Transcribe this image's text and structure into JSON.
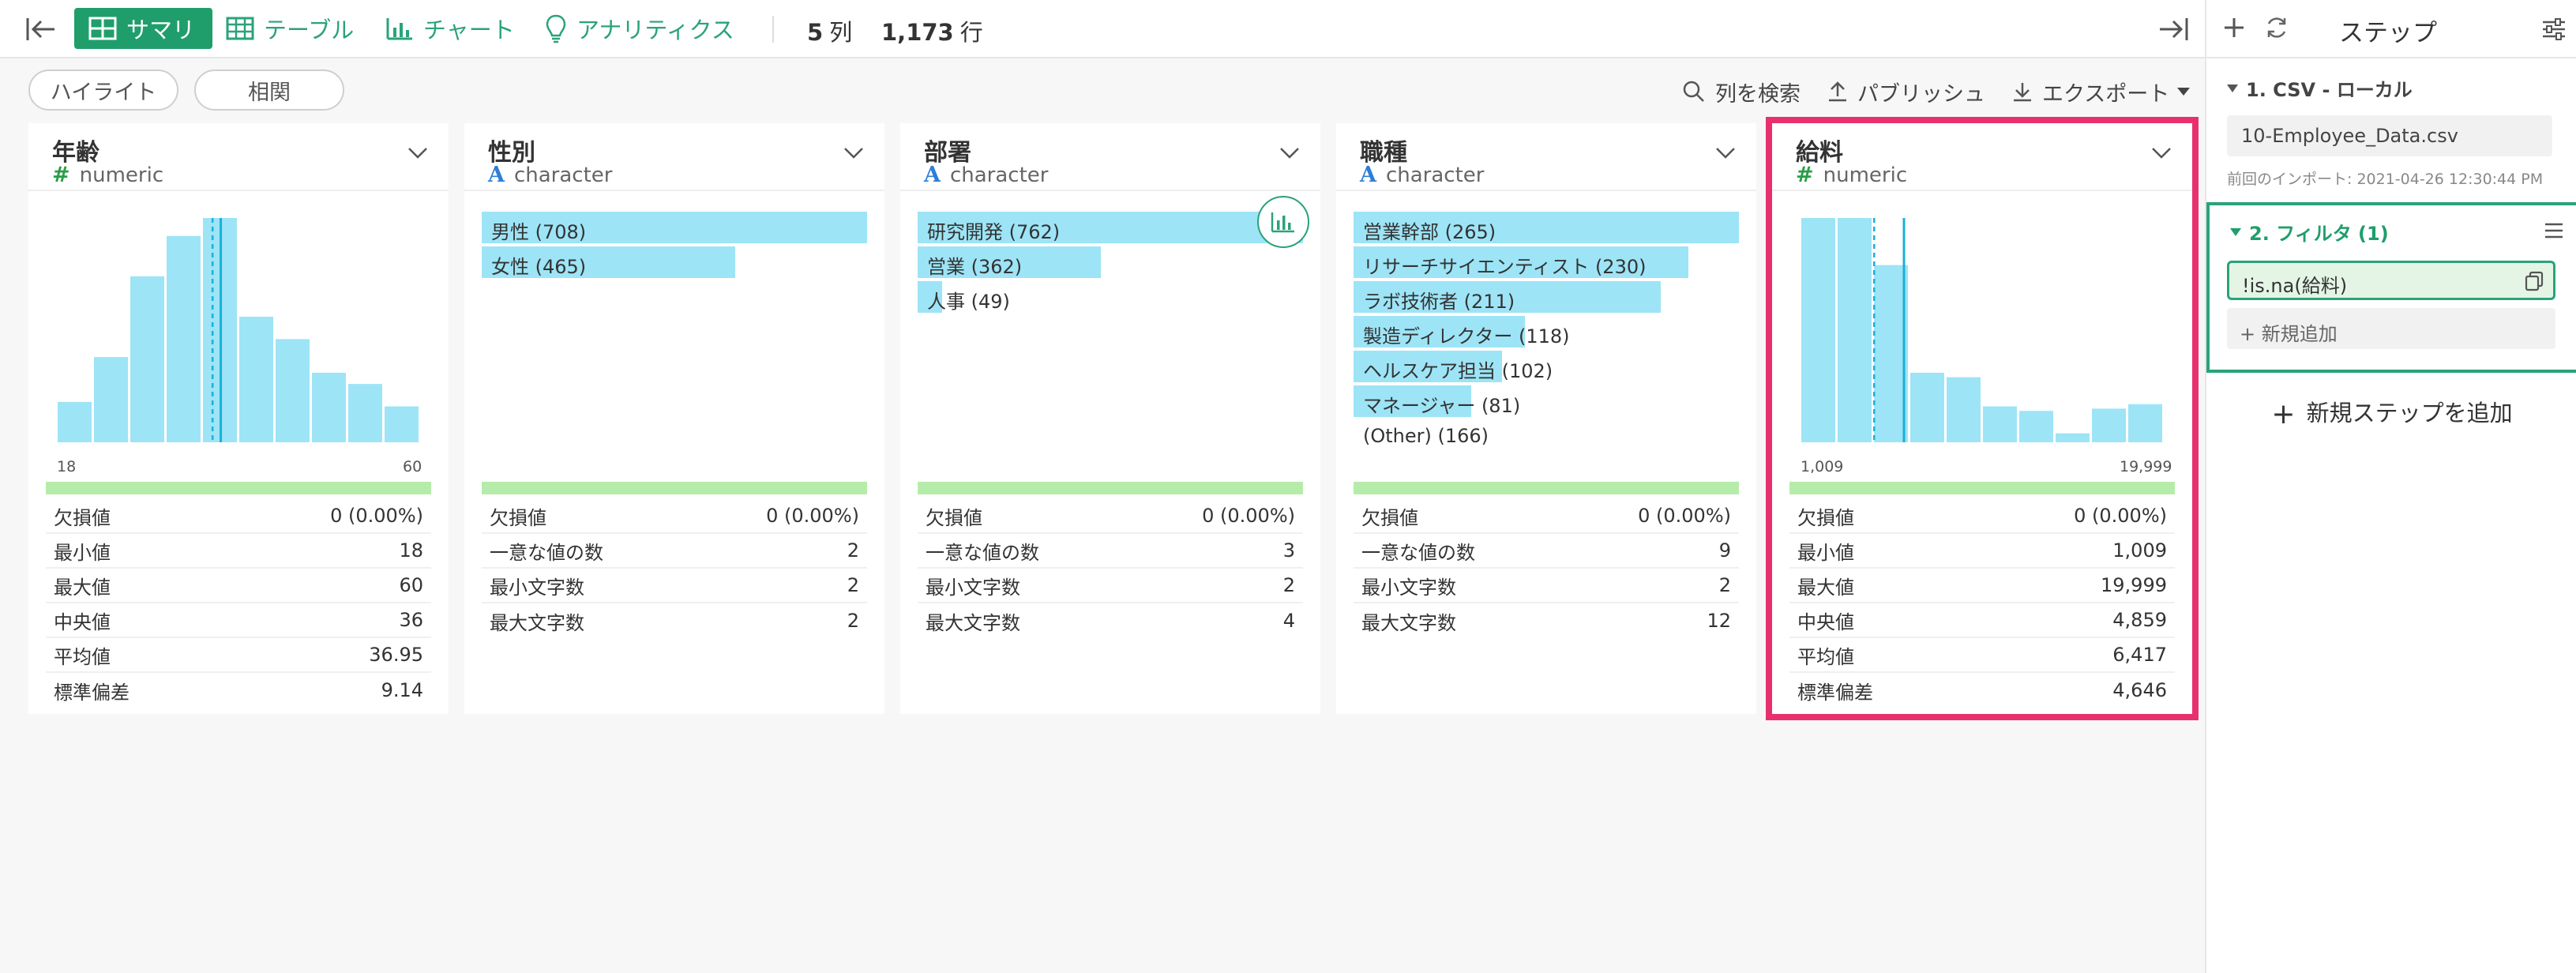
{
  "toolbar": {
    "tabs": [
      {
        "label": "サマリ",
        "icon": "summary-grid-icon",
        "active": true
      },
      {
        "label": "テーブル",
        "icon": "table-icon",
        "active": false
      },
      {
        "label": "チャート",
        "icon": "bar-chart-icon",
        "active": false
      },
      {
        "label": "アナリティクス",
        "icon": "lightbulb-icon",
        "active": false
      }
    ],
    "columns_count": "5",
    "columns_unit": "列",
    "rows_count": "1,173",
    "rows_unit": "行"
  },
  "subbar": {
    "highlight_label": "ハイライト",
    "correlation_label": "相関",
    "search_label": "列を検索",
    "publish_label": "パブリッシュ",
    "export_label": "エクスポート"
  },
  "colors": {
    "accent": "#1f9e6c",
    "bar": "#9de4f6",
    "bar_edge": "#3fc4e8",
    "quality": "#b6ecaa",
    "highlight": "#e8306f"
  },
  "columns": [
    {
      "name": "年齢",
      "type": "numeric",
      "range_min": "18",
      "range_max": "60",
      "stats": [
        {
          "label": "欠損値",
          "value": "0 (0.00%)"
        },
        {
          "label": "最小値",
          "value": "18"
        },
        {
          "label": "最大値",
          "value": "60"
        },
        {
          "label": "中央値",
          "value": "36"
        },
        {
          "label": "平均値",
          "value": "36.95"
        },
        {
          "label": "標準偏差",
          "value": "9.14"
        }
      ]
    },
    {
      "name": "性別",
      "type": "character",
      "categories": [
        {
          "label": "男性 (708)",
          "count": 708
        },
        {
          "label": "女性 (465)",
          "count": 465
        }
      ],
      "stats": [
        {
          "label": "欠損値",
          "value": "0 (0.00%)"
        },
        {
          "label": "一意な値の数",
          "value": "2"
        },
        {
          "label": "最小文字数",
          "value": "2"
        },
        {
          "label": "最大文字数",
          "value": "2"
        }
      ]
    },
    {
      "name": "部署",
      "type": "character",
      "categories": [
        {
          "label": "研究開発 (762)",
          "count": 762
        },
        {
          "label": "営業 (362)",
          "count": 362
        },
        {
          "label": "人事 (49)",
          "count": 49
        }
      ],
      "stats": [
        {
          "label": "欠損値",
          "value": "0 (0.00%)"
        },
        {
          "label": "一意な値の数",
          "value": "3"
        },
        {
          "label": "最小文字数",
          "value": "2"
        },
        {
          "label": "最大文字数",
          "value": "4"
        }
      ]
    },
    {
      "name": "職種",
      "type": "character",
      "categories": [
        {
          "label": "営業幹部 (265)",
          "count": 265
        },
        {
          "label": "リサーチサイエンティスト (230)",
          "count": 230
        },
        {
          "label": "ラボ技術者 (211)",
          "count": 211
        },
        {
          "label": "製造ディレクター (118)",
          "count": 118
        },
        {
          "label": "ヘルスケア担当 (102)",
          "count": 102
        },
        {
          "label": "マネージャー (81)",
          "count": 81
        },
        {
          "label": "(Other) (166)",
          "count": 0
        }
      ],
      "stats": [
        {
          "label": "欠損値",
          "value": "0 (0.00%)"
        },
        {
          "label": "一意な値の数",
          "value": "9"
        },
        {
          "label": "最小文字数",
          "value": "2"
        },
        {
          "label": "最大文字数",
          "value": "12"
        }
      ]
    },
    {
      "name": "給料",
      "type": "numeric",
      "range_min": "1,009",
      "range_max": "19,999",
      "stats": [
        {
          "label": "欠損値",
          "value": "0 (0.00%)"
        },
        {
          "label": "最小値",
          "value": "1,009"
        },
        {
          "label": "最大値",
          "value": "19,999"
        },
        {
          "label": "中央値",
          "value": "4,859"
        },
        {
          "label": "平均値",
          "value": "6,417"
        },
        {
          "label": "標準偏差",
          "value": "4,646"
        }
      ]
    }
  ],
  "chart_data": [
    {
      "type": "bar",
      "categories": [
        "1",
        "2",
        "3",
        "4",
        "5",
        "6",
        "7",
        "8",
        "9",
        "10"
      ],
      "values": [
        18,
        38,
        74,
        92,
        100,
        56,
        46,
        31,
        26,
        16
      ],
      "ylim": [
        0,
        100
      ],
      "xlim": [
        18,
        60
      ],
      "median": 36,
      "mean": 36.95
    },
    {
      "type": "bar",
      "categories": [
        "1",
        "2",
        "3",
        "4",
        "5",
        "6",
        "7",
        "8",
        "9",
        "10"
      ],
      "values": [
        100,
        100,
        79,
        31,
        29,
        16,
        14,
        4,
        15,
        17
      ],
      "ylim": [
        0,
        100
      ],
      "xlim": [
        1009,
        19999
      ],
      "median": 4859,
      "mean": 6417
    }
  ],
  "right_panel": {
    "title": "ステップ",
    "step1_title": "1. CSV - ローカル",
    "file_name": "10-Employee_Data.csv",
    "import_time": "前回のインポート: 2021-04-26 12:30:44 PM",
    "step2_title": "2. フィルタ (1)",
    "filter_condition": "!is.na(給料)",
    "add_new_label": "+ 新規追加",
    "add_step_label": "新規ステップを追加"
  }
}
